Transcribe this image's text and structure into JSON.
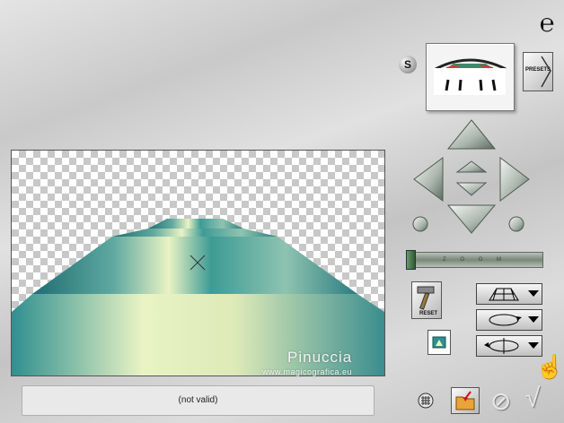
{
  "header": {
    "logo_glyph": "℮"
  },
  "buttons": {
    "s_label": "S",
    "presets_label": "PRESETS",
    "reset_label": "RESET",
    "zoom_label": "Z O O M",
    "no_glyph": "⊘",
    "ok_glyph": "√",
    "hand_glyph": "☝"
  },
  "canvas": {
    "watermark_name": "Pinuccia",
    "watermark_url": "www.magicografica.eu"
  },
  "status": {
    "text": "(not valid)"
  },
  "dropdowns": [
    {
      "icon": "perspective-grid"
    },
    {
      "icon": "rotate-circle"
    },
    {
      "icon": "flip-circle"
    }
  ],
  "colors": {
    "teal": "#2f8f8f",
    "pale_yellow": "#e9f3c4",
    "dark_teal": "#1f6d73"
  }
}
